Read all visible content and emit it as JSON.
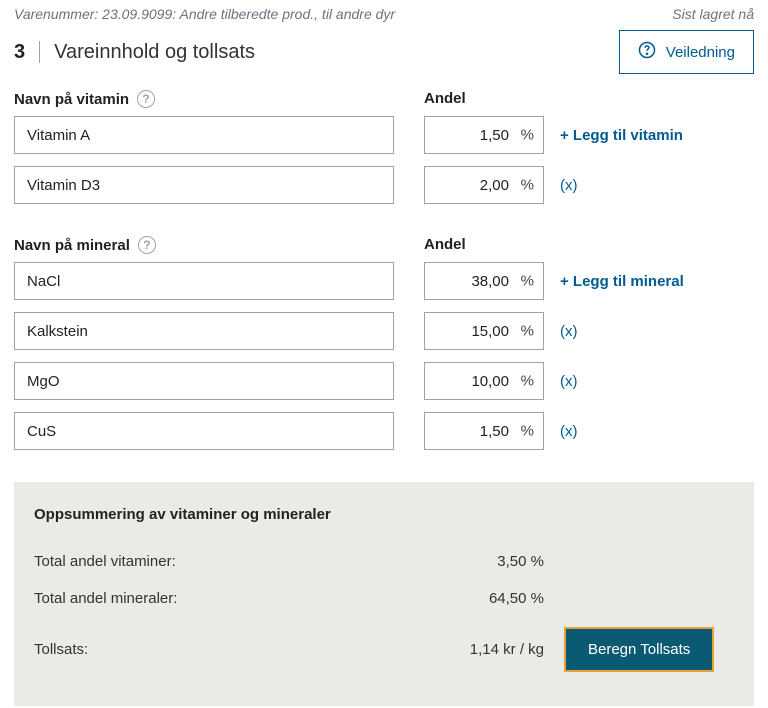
{
  "header": {
    "vare": "Varenummer: 23.09.9099: Andre tilberedte prod., til andre dyr",
    "saved": "Sist lagret nå",
    "step": "3",
    "title": "Vareinnhold og tollsats",
    "guide": "Veiledning"
  },
  "vitamin": {
    "nameLabel": "Navn på vitamin",
    "andelLabel": "Andel",
    "addLabel": "+ Legg til vitamin",
    "removeLabel": "(x)",
    "rows": [
      {
        "name": "Vitamin A",
        "andel": "1,50"
      },
      {
        "name": "Vitamin D3",
        "andel": "2,00"
      }
    ]
  },
  "mineral": {
    "nameLabel": "Navn på mineral",
    "andelLabel": "Andel",
    "addLabel": "+ Legg til mineral",
    "removeLabel": "(x)",
    "rows": [
      {
        "name": "NaCl",
        "andel": "38,00"
      },
      {
        "name": "Kalkstein",
        "andel": "15,00"
      },
      {
        "name": "MgO",
        "andel": "10,00"
      },
      {
        "name": "CuS",
        "andel": "1,50"
      }
    ]
  },
  "summary": {
    "title": "Oppsummering av vitaminer og mineraler",
    "vitLabel": "Total andel vitaminer:",
    "vitValue": "3,50 %",
    "minLabel": "Total andel mineraler:",
    "minValue": "64,50 %",
    "tollsatsLabel": "Tollsats:",
    "tollsatsValue": "1,14 kr / kg",
    "calcLabel": "Beregn Tollsats"
  },
  "pct": "%"
}
